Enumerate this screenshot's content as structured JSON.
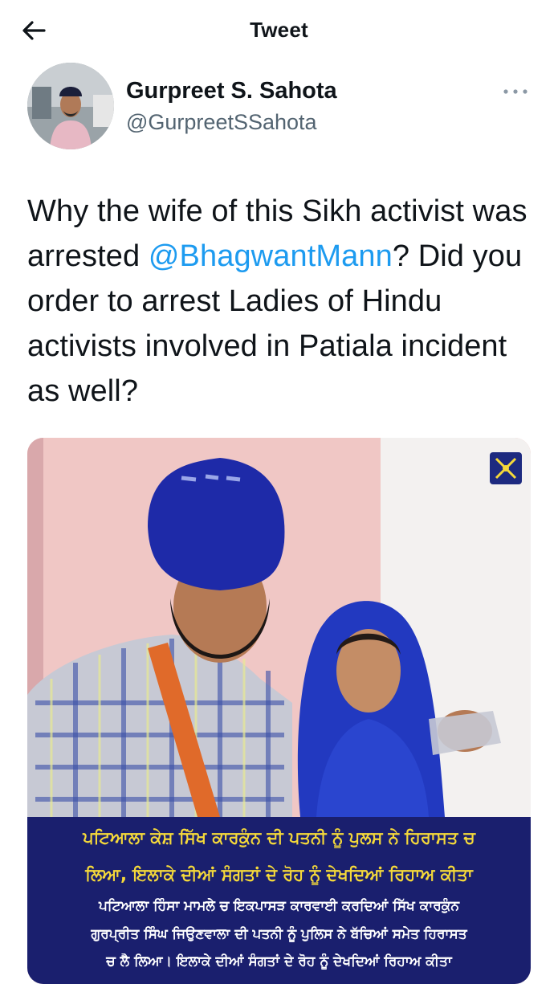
{
  "topbar": {
    "title": "Tweet",
    "back_icon": "arrow-left-icon"
  },
  "author": {
    "name": "Gurpreet S. Sahota",
    "handle": "@GurpreetSSahota",
    "more_icon": "more-horizontal-icon"
  },
  "tweet": {
    "text_part1": "Why the wife of this Sikh activist was arrested ",
    "mention": "@BhagwantMann",
    "text_part2": "? Did you order to arrest Ladies of Hindu activists involved in Patiala incident as well?"
  },
  "media": {
    "caption_lines": [
      "ਪਟਿਆਲਾ ਕੇਸ਼ ਸਿੱਖ ਕਾਰਕੁੰਨ ਦੀ ਪਤਨੀ ਨੂੰ ਪੁਲਸ ਨੇ ਹਿਰਾਸਤ ਚ",
      "ਲਿਆ, ਇਲਾਕੇ ਦੀਆਂ ਸੰਗਤਾਂ ਦੇ ਰੋਹ ਨੂੰ ਦੇਖਦਿਆਂ ਰਿਹਾਅ ਕੀਤਾ",
      "ਪਟਿਆਲਾ ਹਿੰਸਾ ਮਾਮਲੇ ਚ ਇਕਪਾਸੜ ਕਾਰਵਾਈ ਕਰਦਿਆਂ ਸਿੱਖ ਕਾਰਕੁੰਨ",
      "ਗੁਰਪ੍ਰੀਤ ਸਿੰਘ ਜਿਉਣਵਾਲਾ ਦੀ ਪਤਨੀ ਨੂੰ ਪੁਲਿਸ ਨੇ ਬੱਚਿਆਂ ਸਮੇਤ ਹਿਰਾਸਤ",
      "ਚ ਲੈ ਲਿਆ। ਇਲਾਕੇ ਦੀਆਂ ਸੰਗਤਾਂ ਦੇ ਰੋਹ ਨੂੰ ਦੇਖਦਿਆਂ ਰਿਹਾਅ ਕੀਤਾ"
    ],
    "logo_icon": "crossed-swords-icon"
  },
  "colors": {
    "link": "#1d9bf0",
    "secondary_text": "#536471",
    "caption_bg": "#1a1f6e",
    "caption_yellow": "#f5d93a",
    "turban_blue": "#1e2aa8",
    "background_pink": "#f1c9c7"
  }
}
